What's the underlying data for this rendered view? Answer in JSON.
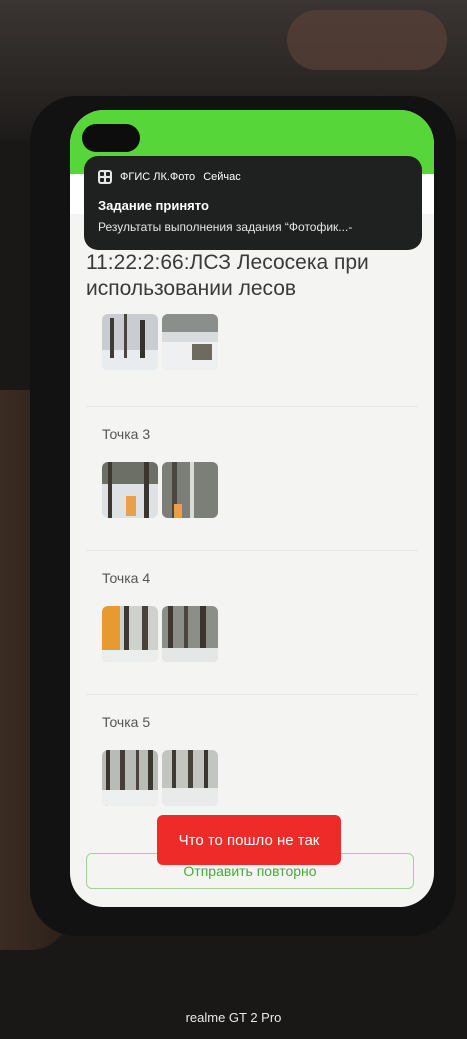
{
  "notification": {
    "app_name": "ФГИС ЛК.Фото",
    "time": "Сейчас",
    "title": "Задание принято",
    "body": "Результаты выполнения задания “Фотофик...-"
  },
  "page": {
    "title": "11:22:2:66:ЛСЗ Лесосека при использовании лесов"
  },
  "points": [
    {
      "label": ""
    },
    {
      "label": "Точка 3"
    },
    {
      "label": "Точка 4"
    },
    {
      "label": "Точка 5"
    }
  ],
  "resend_button": {
    "label": "Отправить повторно"
  },
  "toast": {
    "message": "Что то пошло не так"
  },
  "device": {
    "label": "realme GT 2 Pro"
  },
  "colors": {
    "status_bar": "#57d63a",
    "toast": "#ef2b2a",
    "resend_text": "#4aa93a"
  }
}
